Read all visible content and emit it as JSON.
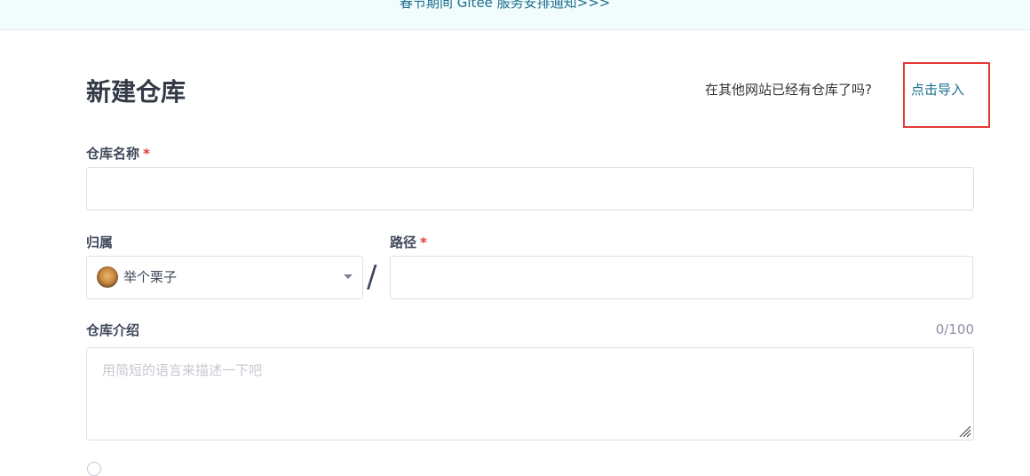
{
  "notice": {
    "text": "春节期间 Gitee 服务安排通知>>>"
  },
  "header": {
    "title": "新建仓库",
    "import_question": "在其他网站已经有仓库了吗?",
    "import_link": "点击导入"
  },
  "form": {
    "repo_name": {
      "label": "仓库名称",
      "required_mark": "*",
      "value": ""
    },
    "owner": {
      "label": "归属",
      "selected": "举个栗子"
    },
    "separator": "/",
    "path": {
      "label": "路径",
      "required_mark": "*",
      "value": ""
    },
    "description": {
      "label": "仓库介绍",
      "counter": "0/100",
      "placeholder": "用简短的语言来描述一下吧",
      "value": ""
    }
  },
  "colors": {
    "link": "#1b6f8f",
    "required": "#e53935",
    "highlight_border": "#e53935",
    "notice_bg": "#f3fcfd"
  },
  "icons": {
    "owner_avatar": "dog-avatar",
    "dropdown": "caret-down-icon",
    "resize": "resize-grip-icon"
  }
}
